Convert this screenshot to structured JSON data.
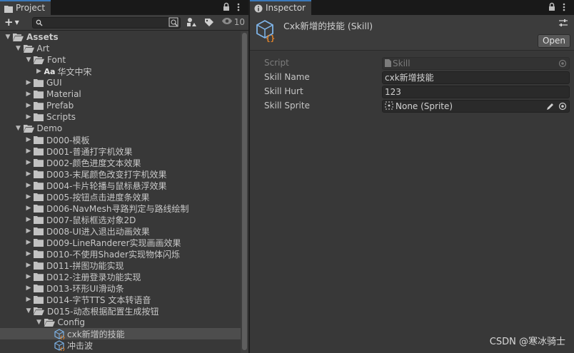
{
  "project_panel": {
    "tab_label": "Project",
    "hidden_count": "10",
    "tree": [
      {
        "label": "Assets",
        "depth": 0,
        "expanded": true,
        "type": "folder",
        "bold": true
      },
      {
        "label": "Art",
        "depth": 1,
        "expanded": true,
        "type": "folder"
      },
      {
        "label": "Font",
        "depth": 2,
        "expanded": true,
        "type": "folder"
      },
      {
        "label": "华文中宋",
        "depth": 3,
        "expanded": false,
        "type": "font",
        "has_arrow": true
      },
      {
        "label": "GUI",
        "depth": 2,
        "expanded": false,
        "type": "folder"
      },
      {
        "label": "Material",
        "depth": 2,
        "expanded": false,
        "type": "folder"
      },
      {
        "label": "Prefab",
        "depth": 2,
        "expanded": false,
        "type": "folder"
      },
      {
        "label": "Scripts",
        "depth": 2,
        "expanded": false,
        "type": "folder"
      },
      {
        "label": "Demo",
        "depth": 1,
        "expanded": true,
        "type": "folder"
      },
      {
        "label": "D000-模板",
        "depth": 2,
        "expanded": false,
        "type": "folder"
      },
      {
        "label": "D001-普通打字机效果",
        "depth": 2,
        "expanded": false,
        "type": "folder"
      },
      {
        "label": "D002-颜色进度文本效果",
        "depth": 2,
        "expanded": false,
        "type": "folder"
      },
      {
        "label": "D003-末尾颜色改变打字机效果",
        "depth": 2,
        "expanded": false,
        "type": "folder"
      },
      {
        "label": "D004-卡片轮播与鼠标悬浮效果",
        "depth": 2,
        "expanded": false,
        "type": "folder"
      },
      {
        "label": "D005-按钮点击进度条效果",
        "depth": 2,
        "expanded": false,
        "type": "folder"
      },
      {
        "label": "D006-NavMesh寻路判定与路线绘制",
        "depth": 2,
        "expanded": false,
        "type": "folder"
      },
      {
        "label": "D007-鼠标框选对象2D",
        "depth": 2,
        "expanded": false,
        "type": "folder"
      },
      {
        "label": "D008-UI进入退出动画效果",
        "depth": 2,
        "expanded": false,
        "type": "folder"
      },
      {
        "label": "D009-LineRanderer实现画画效果",
        "depth": 2,
        "expanded": false,
        "type": "folder"
      },
      {
        "label": "D010-不使用Shader实现物体闪烁",
        "depth": 2,
        "expanded": false,
        "type": "folder"
      },
      {
        "label": "D011-拼图功能实现",
        "depth": 2,
        "expanded": false,
        "type": "folder"
      },
      {
        "label": "D012-注册登录功能实现",
        "depth": 2,
        "expanded": false,
        "type": "folder"
      },
      {
        "label": "D013-环形UI滑动条",
        "depth": 2,
        "expanded": false,
        "type": "folder"
      },
      {
        "label": "D014-字节TTS 文本转语音",
        "depth": 2,
        "expanded": false,
        "type": "folder"
      },
      {
        "label": "D015-动态根据配置生成按钮",
        "depth": 2,
        "expanded": true,
        "type": "folder"
      },
      {
        "label": "Config",
        "depth": 3,
        "expanded": true,
        "type": "folder"
      },
      {
        "label": "cxk新增的技能",
        "depth": 4,
        "type": "asset",
        "selected": true
      },
      {
        "label": "冲击波",
        "depth": 4,
        "type": "asset"
      }
    ]
  },
  "inspector": {
    "tab_label": "Inspector",
    "title": "Cxk新增的技能 (Skill)",
    "open_label": "Open",
    "fields": [
      {
        "label": "Script",
        "value": "Skill",
        "disabled": true
      },
      {
        "label": "Skill Name",
        "value": "cxk新增技能"
      },
      {
        "label": "Skill Hurt",
        "value": "123"
      },
      {
        "label": "Skill Sprite",
        "value": "None (Sprite)"
      }
    ]
  },
  "watermark": "CSDN @寒冰骑士"
}
